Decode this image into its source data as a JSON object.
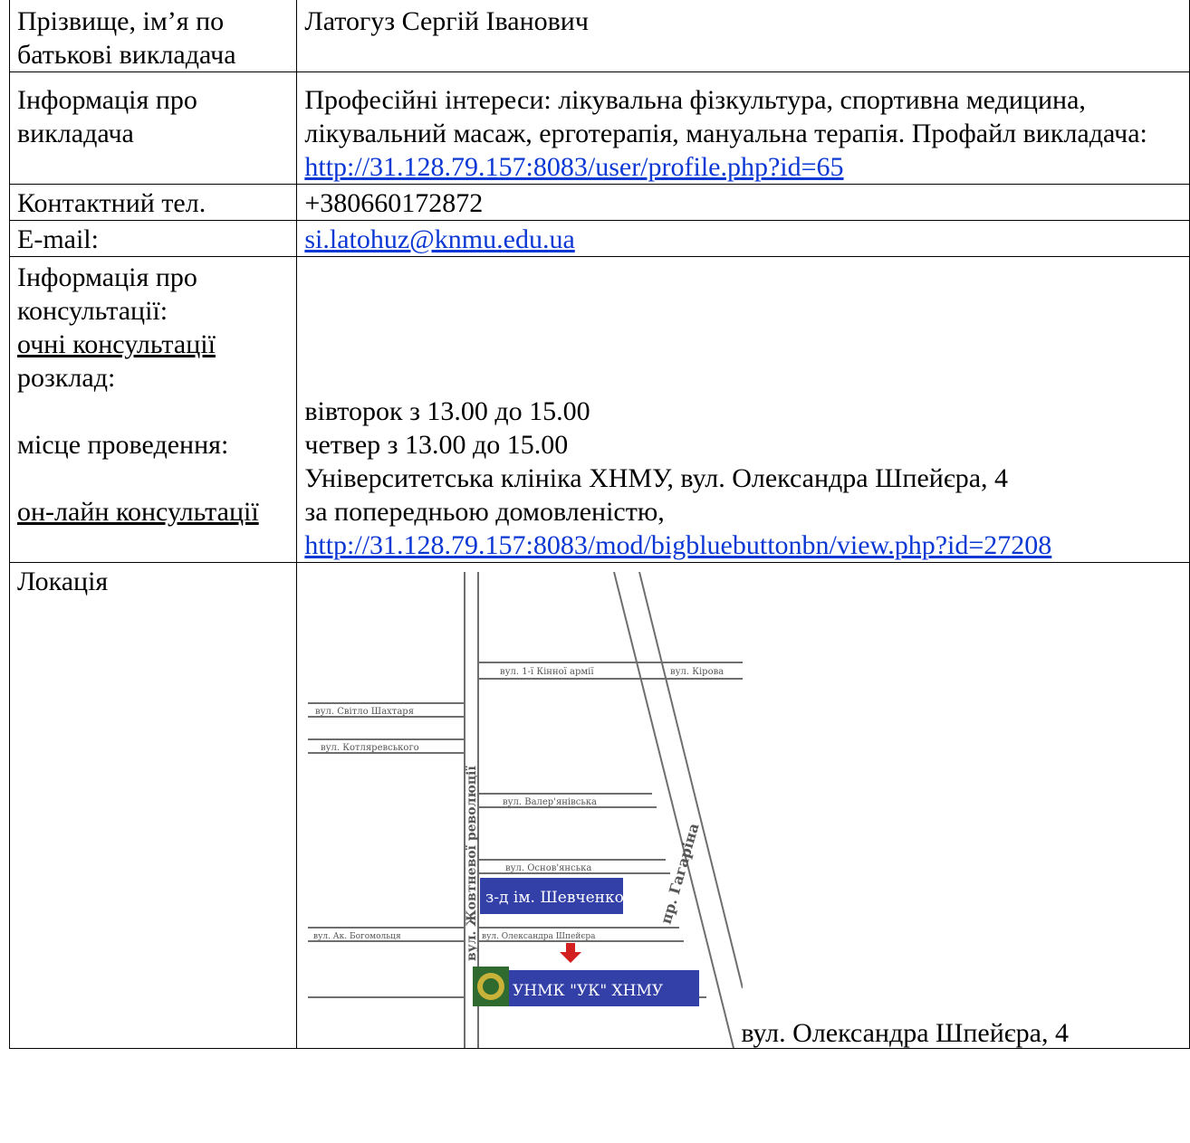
{
  "rows": {
    "name": {
      "label": "Прізвище, ім’я по батькові викладача",
      "value": "Латогуз Сергій Іванович"
    },
    "info": {
      "label": "Інформація про викладача",
      "text": "Професійні інтереси: лікувальна фізкультура, спортивна медицина, лікувальний масаж, ерготерапія, мануальна терапія. Профайл викладача:",
      "link": "http://31.128.79.157:8083/user/profile.php?id=65"
    },
    "phone": {
      "label": "Контактний тел.",
      "value": "+380660172872"
    },
    "email": {
      "label": "E-mail:",
      "value": "si.latohuz@knmu.edu.ua"
    },
    "consult": {
      "label": "Інформація про консультації:",
      "offline_label": "очні консультації",
      "schedule_label": "розклад:",
      "schedule_1": "вівторок з 13.00 до 15.00",
      "schedule_2": "четвер з 13.00 до 15.00",
      "place_label": "місце проведення:",
      "place_value": "Університетська клініка ХНМУ, вул. Олександра Шпейєра, 4",
      "online_label": "он-лайн консультації",
      "online_text": "за попередньою домовленістю,",
      "online_link": "http://31.128.79.157:8083/mod/bigbluebuttonbn/view.php?id=27208"
    },
    "location": {
      "label": "Локація",
      "caption": "вул. Олександра Шпейєра, 4",
      "map": {
        "streets": {
          "first_cavalry": "вул. 1-ї Кінної армії",
          "kirova": "вул. Кірова",
          "svitlo_shakhtarya": "вул. Світло Шахтаря",
          "kotlyarevskogo": "вул. Котляревського",
          "valeryanivska": "вул. Валер'янівська",
          "osnovyanska": "вул. Основ'янська",
          "bogomoltsya": "вул. Ак. Богомольця",
          "shpeyera": "вул. Олександра Шпейєра",
          "zhovtnevoi": "вул. Жовтневої революції",
          "gagarina": "пр. Гагаріна"
        },
        "plant_label": "з-д ім. Шевченко",
        "clinic_label": "УНМК \"УК\" ХНМУ",
        "box_color": "#3340a8"
      }
    }
  }
}
